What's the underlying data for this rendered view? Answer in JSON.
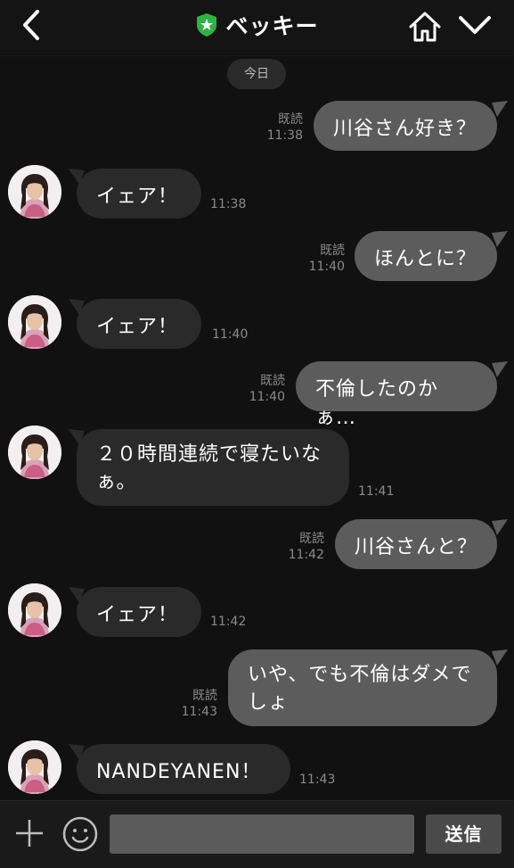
{
  "header": {
    "title": "ベッキー",
    "icons": [
      "back-icon",
      "official-shield-icon",
      "home-icon",
      "chevron-down-icon"
    ]
  },
  "date_label": "今日",
  "messages": [
    {
      "side": "out",
      "text": "川谷さん好き？",
      "read": "既読",
      "time": "11:38"
    },
    {
      "side": "in",
      "text": "イェア！",
      "time": "11:38"
    },
    {
      "side": "out",
      "text": "ほんとに？",
      "read": "既読",
      "time": "11:40"
    },
    {
      "side": "in",
      "text": "イェア！",
      "time": "11:40"
    },
    {
      "side": "out",
      "text": "不倫したのかぁ…",
      "read": "既読",
      "time": "11:40"
    },
    {
      "side": "in",
      "lines": [
        "２０時間連続で寝たいな",
        "ぁ。"
      ],
      "time": "11:41"
    },
    {
      "side": "out",
      "text": "川谷さんと？",
      "read": "既読",
      "time": "11:42"
    },
    {
      "side": "in",
      "text": "イェア！",
      "time": "11:42"
    },
    {
      "side": "out",
      "lines": [
        "いや、でも不倫はダメで",
        "しょ"
      ],
      "read": "既読",
      "time": "11:43"
    },
    {
      "side": "in",
      "text": "NANDEYANEN！",
      "time": "11:43"
    }
  ],
  "footer": {
    "input_value": "",
    "send_label": "送信"
  },
  "colors": {
    "background": "#111111",
    "outgoing_bubble": "#5c5c5c",
    "incoming_bubble": "#2a2a2a",
    "accent_green": "#2fb344"
  }
}
